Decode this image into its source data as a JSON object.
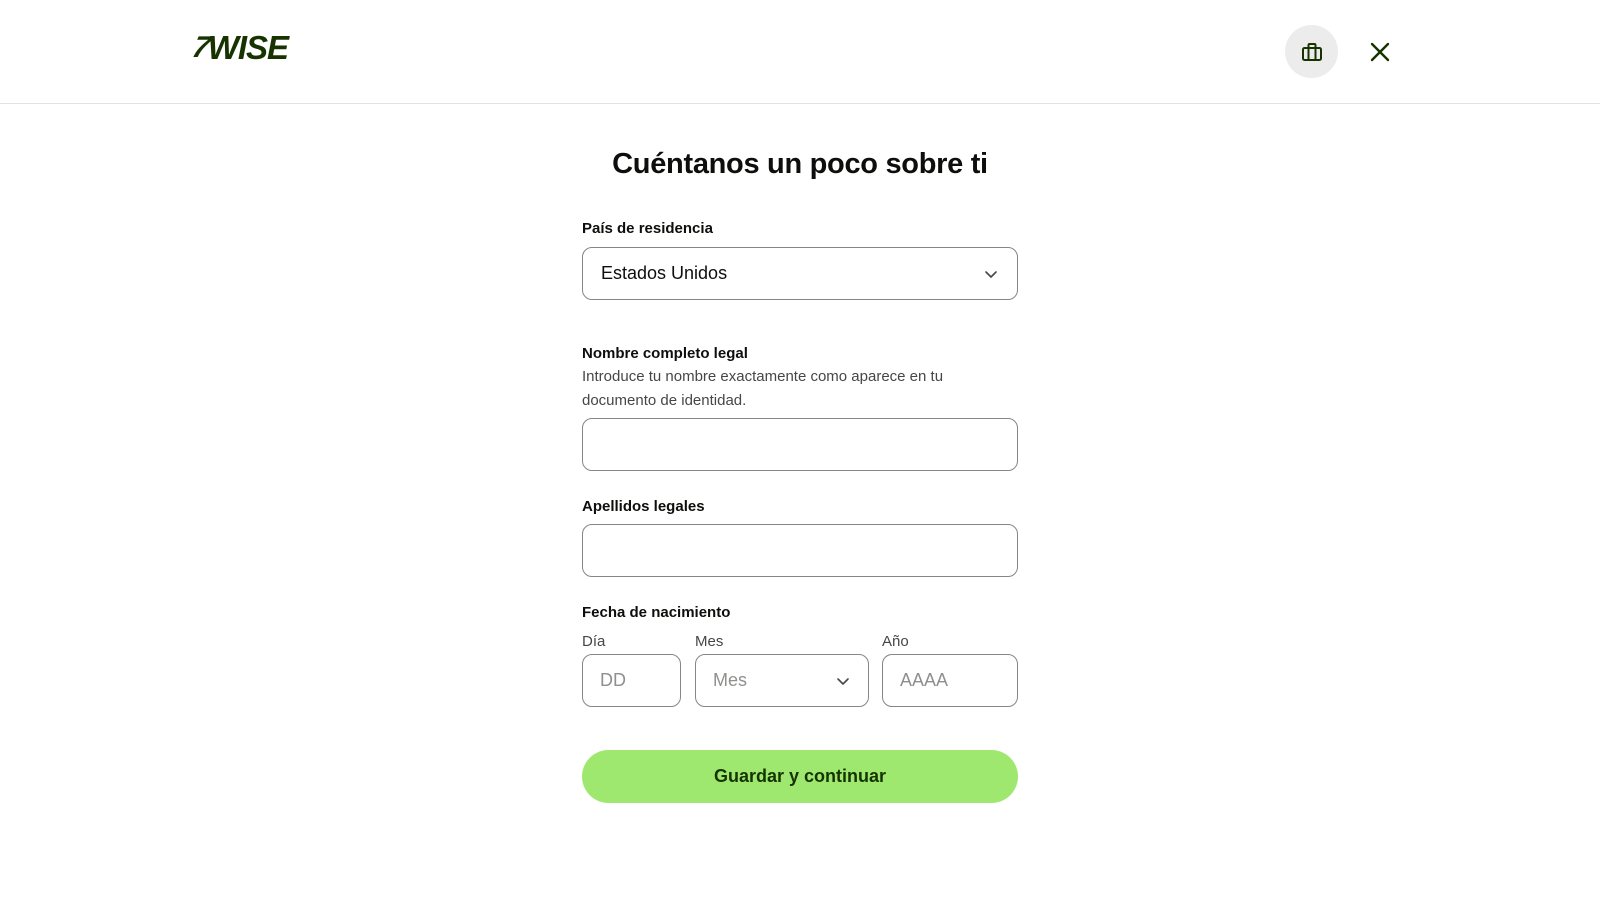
{
  "header": {
    "logo_text": "WISE",
    "logo_flag": "7",
    "business_button_icon": "briefcase-icon",
    "close_button_icon": "close-icon"
  },
  "form": {
    "title": "Cuéntanos un poco sobre ti",
    "country": {
      "label": "País de residencia",
      "value": "Estados Unidos"
    },
    "full_name": {
      "label": "Nombre completo legal",
      "help": "Introduce tu nombre exactamente como aparece en tu documento de identidad.",
      "value": ""
    },
    "last_names": {
      "label": "Apellidos legales",
      "value": ""
    },
    "birth_date": {
      "label": "Fecha de nacimiento",
      "day_label": "Día",
      "day_placeholder": "DD",
      "month_label": "Mes",
      "month_value": "Mes",
      "year_label": "Año",
      "year_placeholder": "AAAA"
    },
    "submit_label": "Guardar y continuar"
  },
  "colors": {
    "brand_dark_green": "#163300",
    "brand_bright_green": "#9fe870",
    "field_border": "#868685"
  }
}
